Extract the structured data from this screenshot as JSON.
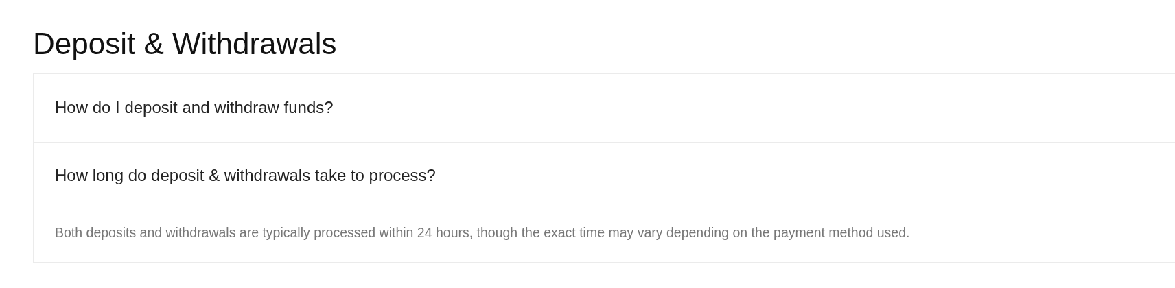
{
  "title": "Deposit & Withdrawals",
  "faq": [
    {
      "question": "How do I deposit and withdraw funds?",
      "expanded": false
    },
    {
      "question": "How long do deposit & withdrawals take to process?",
      "expanded": true,
      "answer": "Both deposits and withdrawals are typically processed within 24 hours, though the exact time may vary depending on the payment method used."
    }
  ]
}
